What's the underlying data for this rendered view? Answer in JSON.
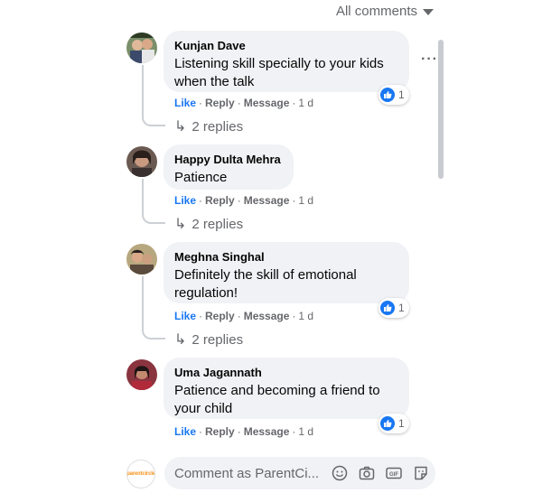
{
  "header": {
    "filter_label": "All comments"
  },
  "comments": [
    {
      "author": "Kunjan Dave",
      "text_lines": [
        "Listening skill specially to your kids",
        "when the talk"
      ],
      "actions": {
        "like": "Like",
        "reply": "Reply",
        "message": "Message",
        "time": "1 d"
      },
      "reaction_count": "1",
      "replies_label": "2 replies"
    },
    {
      "author": "Happy Dulta Mehra",
      "text_lines": [
        "Patience"
      ],
      "actions": {
        "like": "Like",
        "reply": "Reply",
        "message": "Message",
        "time": "1 d"
      },
      "replies_label": "2 replies"
    },
    {
      "author": "Meghna Singhal",
      "text_lines": [
        "Definitely the skill of emotional",
        "regulation!"
      ],
      "actions": {
        "like": "Like",
        "reply": "Reply",
        "message": "Message",
        "time": "1 d"
      },
      "reaction_count": "1",
      "replies_label": "2 replies"
    },
    {
      "author": "Uma Jagannath",
      "text_lines": [
        "Patience and becoming a friend to",
        "your child"
      ],
      "actions": {
        "like": "Like",
        "reply": "Reply",
        "message": "Message",
        "time": "1 d"
      },
      "reaction_count": "1"
    }
  ],
  "composer": {
    "placeholder": "Comment as ParentCi...",
    "avatar_text": "parentcircle"
  },
  "icons": {
    "filter": "caret-down-icon",
    "more": "more-options-icon",
    "reply": "reply-arrow-icon",
    "reaction": "thumbs-up-icon",
    "emoji": "emoji-icon",
    "camera": "camera-icon",
    "gif": "gif-icon",
    "sticker": "sticker-icon"
  },
  "colors": {
    "accent": "#1877f2",
    "bubble": "#f0f2f5",
    "muted": "#65676b",
    "logo": "#f7931e"
  }
}
